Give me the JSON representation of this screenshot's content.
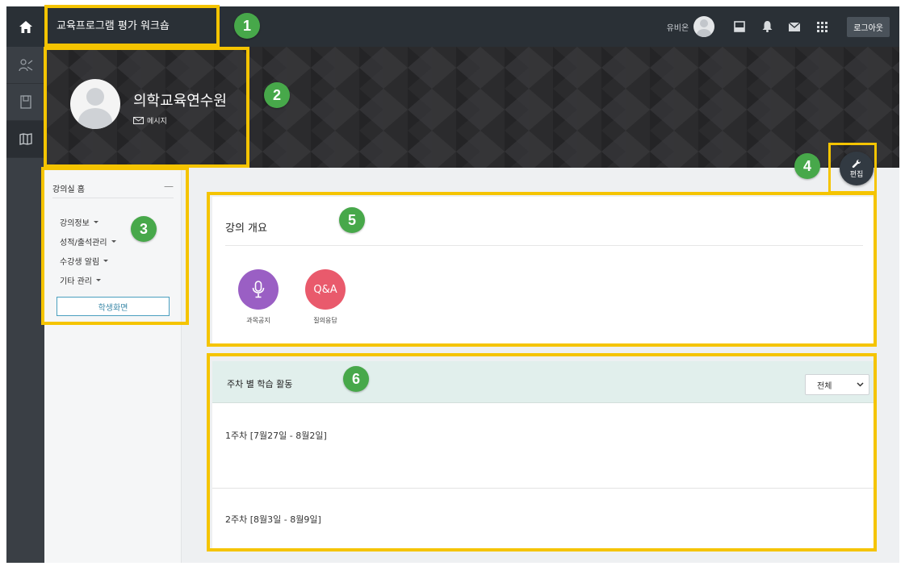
{
  "header": {
    "site_title": "교육프로그램 평가 워크숍",
    "user_name": "유비온",
    "logout_label": "로그아웃"
  },
  "profile": {
    "name": "의학교육연수원",
    "message_label": "메시지"
  },
  "edit": {
    "label": "편집"
  },
  "course_menu": {
    "title": "강의실 홈",
    "collapse": "—",
    "items": [
      {
        "label": "강의정보"
      },
      {
        "label": "성적/출석관리"
      },
      {
        "label": "수강생 알림"
      },
      {
        "label": "기타 관리"
      }
    ],
    "student_view_label": "학생화면"
  },
  "overview": {
    "title": "강의 개요",
    "items": [
      {
        "label": "과목공지",
        "icon": "microphone-icon",
        "color": "#9a5fc4"
      },
      {
        "label": "질의응답",
        "icon_text": "Q&A",
        "color": "#e95a6c"
      }
    ]
  },
  "weekly": {
    "title": "주차 별 학습 활동",
    "filter_value": "전체",
    "weeks": [
      {
        "label": "1주차 [7월27일 - 8월2일]"
      },
      {
        "label": "2주차 [8월3일 - 8월9일]"
      }
    ]
  },
  "annotations": {
    "badges": [
      "1",
      "2",
      "3",
      "4",
      "5",
      "6"
    ],
    "highlight_color": "#f5c400",
    "badge_color": "#47a84a"
  }
}
